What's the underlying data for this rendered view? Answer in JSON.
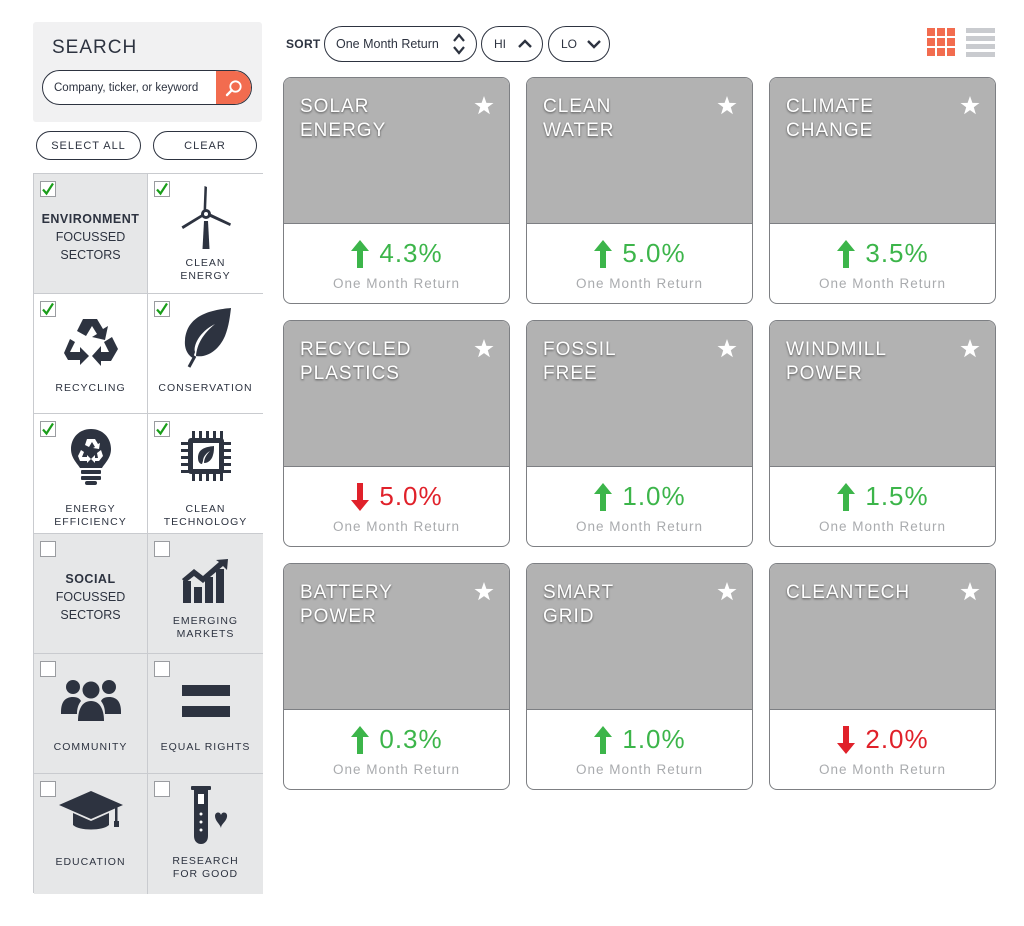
{
  "search": {
    "title": "SEARCH",
    "placeholder": "Company, ticker, or keyword"
  },
  "buttons": {
    "select_all": "SELECT ALL",
    "clear": "CLEAR"
  },
  "groups": {
    "environment": {
      "title": "ENVIRONMENT",
      "line1": "FOCUSSED",
      "line2": "SECTORS",
      "checked": true
    },
    "social": {
      "title": "SOCIAL",
      "line1": "FOCUSSED",
      "line2": "SECTORS",
      "checked": false
    }
  },
  "sectors": [
    {
      "id": "clean-energy",
      "label": "CLEAN\nENERGY",
      "icon": "wind-turbine-icon",
      "checked": true
    },
    {
      "id": "recycling",
      "label": "RECYCLING",
      "icon": "recycle-icon",
      "checked": true
    },
    {
      "id": "conservation",
      "label": "CONSERVATION",
      "icon": "leaf-icon",
      "checked": true
    },
    {
      "id": "energy-efficiency",
      "label": "ENERGY\nEFFICIENCY",
      "icon": "lightbulb-recycle-icon",
      "checked": true
    },
    {
      "id": "clean-technology",
      "label": "CLEAN\nTECHNOLOGY",
      "icon": "chip-leaf-icon",
      "checked": true
    },
    {
      "id": "emerging-markets",
      "label": "EMERGING\nMARKETS",
      "icon": "bar-chart-icon",
      "checked": false
    },
    {
      "id": "community",
      "label": "COMMUNITY",
      "icon": "people-icon",
      "checked": false
    },
    {
      "id": "equal-rights",
      "label": "EQUAL RIGHTS",
      "icon": "equals-icon",
      "checked": false
    },
    {
      "id": "education",
      "label": "EDUCATION",
      "icon": "graduation-cap-icon",
      "checked": false
    },
    {
      "id": "research-for-good",
      "label": "RESEARCH\nFOR GOOD",
      "icon": "test-tube-heart-icon",
      "checked": false
    }
  ],
  "toolbar": {
    "sort_label": "SORT",
    "sort_value": "One Month Return",
    "hi_label": "HI",
    "lo_label": "LO"
  },
  "cards": [
    {
      "line1": "SOLAR",
      "line2": "ENERGY",
      "value": "4.3%",
      "direction": "up",
      "sub": "One Month Return"
    },
    {
      "line1": "CLEAN",
      "line2": "WATER",
      "value": "5.0%",
      "direction": "up",
      "sub": "One Month Return"
    },
    {
      "line1": "CLIMATE",
      "line2": "CHANGE",
      "value": "3.5%",
      "direction": "up",
      "sub": "One Month Return"
    },
    {
      "line1": "RECYCLED",
      "line2": "PLASTICS",
      "value": "5.0%",
      "direction": "down",
      "sub": "One Month Return"
    },
    {
      "line1": "FOSSIL",
      "line2": "FREE",
      "value": "1.0%",
      "direction": "up",
      "sub": "One Month Return"
    },
    {
      "line1": "WINDMILL",
      "line2": "POWER",
      "value": "1.5%",
      "direction": "up",
      "sub": "One Month Return"
    },
    {
      "line1": "BATTERY",
      "line2": "POWER",
      "value": "0.3%",
      "direction": "up",
      "sub": "One Month Return"
    },
    {
      "line1": "SMART",
      "line2": "GRID",
      "value": "1.0%",
      "direction": "up",
      "sub": "One Month Return"
    },
    {
      "line1": "CLEANTECH",
      "line2": "",
      "value": "2.0%",
      "direction": "down",
      "sub": "One Month Return"
    }
  ],
  "colors": {
    "accent": "#f26c4f",
    "up": "#3cb54a",
    "down": "#e0212a",
    "navy": "#2d3340",
    "card_top": "#b2b2b2",
    "view_grid_active": "#f26c4f",
    "view_list_inactive": "#c9cbcf"
  }
}
